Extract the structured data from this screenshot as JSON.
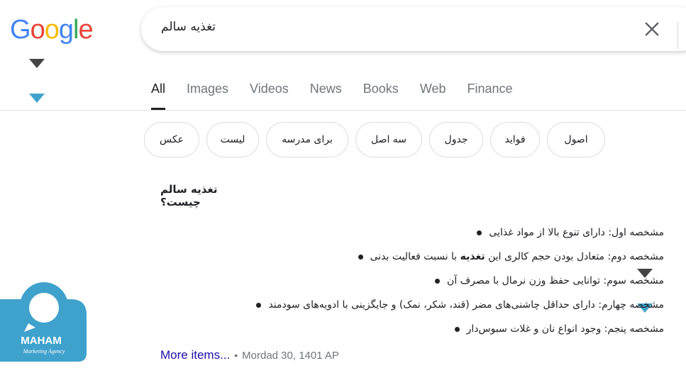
{
  "logo": {
    "letters": [
      "G",
      "o",
      "o",
      "g",
      "l",
      "e"
    ],
    "colors": [
      "#4285f4",
      "#ea4335",
      "#fbbc05",
      "#4285f4",
      "#34a853",
      "#ea4335"
    ]
  },
  "search": {
    "query": "تغذیه سالم",
    "clear_icon": "close-icon"
  },
  "tabs": [
    {
      "label": "All",
      "active": true
    },
    {
      "label": "Images"
    },
    {
      "label": "Videos"
    },
    {
      "label": "News"
    },
    {
      "label": "Books"
    },
    {
      "label": "Web"
    },
    {
      "label": "Finance"
    }
  ],
  "chips": [
    "عکس",
    "لیست",
    "برای مدرسه",
    "سه اصل",
    "جدول",
    "فواید",
    "اصول"
  ],
  "answer": {
    "title": "تغذیه سالم چیست؟",
    "items": [
      {
        "text": "مشخصه اول: دارای تنوع بالا از مواد غذایی"
      },
      {
        "pre": "مشخصه دوم: متعادل بودن حجم کالری این ",
        "bold": "تغذیه",
        "post": " با نسبت فعالیت بدنی"
      },
      {
        "text": "مشخصه سوم: توانایی حفظ وزن نرمال با مصرف آن"
      },
      {
        "text": "مشخصه چهارم: دارای حداقل چاشنی‌های مضر (قند، شکر، نمک) و جایگزینی با ادویه‌های سودمند"
      },
      {
        "text": "مشخصه پنجم: وجود انواع نان و غلات سبوس‌دار"
      }
    ],
    "more_link": "More items...",
    "separator": "•",
    "date": "Mordad 30, 1401 AP"
  },
  "watermark": {
    "brand": "MAHAM",
    "tagline": "Marketing Agency",
    "color": "#3fa2cc"
  }
}
